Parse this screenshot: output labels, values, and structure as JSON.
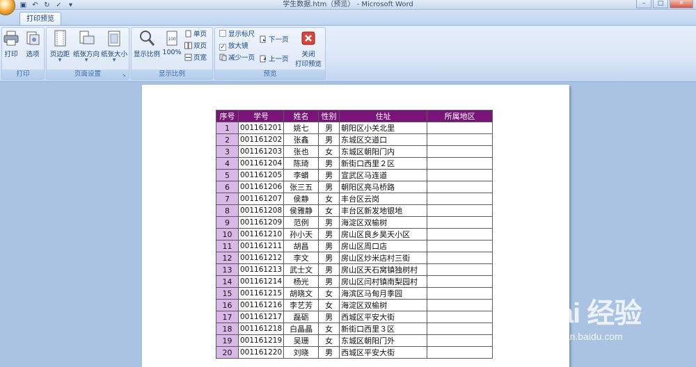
{
  "window": {
    "title": "学生数据.htm（预览） - Microsoft Word"
  },
  "tabs": [
    {
      "label": "打印预览"
    }
  ],
  "ribbon": {
    "print_group": {
      "label": "打印",
      "print": "打印",
      "options": "选项"
    },
    "page_setup_group": {
      "label": "页面设置",
      "margins": "页边距",
      "orientation": "纸张方向",
      "size": "纸张大小"
    },
    "zoom_group": {
      "label": "显示比例",
      "zoom": "显示比例",
      "hundred": "100%",
      "one_page": "单页",
      "two_pages": "双页",
      "page_width": "页宽"
    },
    "preview_group": {
      "label": "预览",
      "show_ruler": "显示标尺",
      "show_ruler_checked": false,
      "magnifier": "放大镜",
      "magnifier_checked": true,
      "shrink": "减少一页",
      "next_page": "下一页",
      "prev_page": "上一页",
      "close": "关闭",
      "close2": "打印预览"
    }
  },
  "table": {
    "headers": [
      "序号",
      "学号",
      "姓名",
      "性别",
      "住址",
      "所属地区"
    ],
    "rows": [
      [
        "1",
        "001161201",
        "姚七",
        "男",
        "朝阳区小关北里",
        ""
      ],
      [
        "2",
        "001161202",
        "张鑫",
        "男",
        "东城区交道口",
        ""
      ],
      [
        "3",
        "001161203",
        "张也",
        "女",
        "东城区朝阳门内",
        ""
      ],
      [
        "4",
        "001161204",
        "陈琦",
        "男",
        "新街口西里２区",
        ""
      ],
      [
        "5",
        "001161205",
        "李蟒",
        "男",
        "宣武区马连道",
        ""
      ],
      [
        "6",
        "001161206",
        "张三五",
        "男",
        "朝阳区亮马桥路",
        ""
      ],
      [
        "7",
        "001161207",
        "侯静",
        "女",
        "丰台区云岗",
        ""
      ],
      [
        "8",
        "001161208",
        "侯雅静",
        "女",
        "丰台区新发地银地",
        ""
      ],
      [
        "9",
        "001161209",
        "范例",
        "男",
        "海淀区双榆树",
        ""
      ],
      [
        "10",
        "001161210",
        "孙小天",
        "男",
        "房山区良乡昊天小区",
        ""
      ],
      [
        "11",
        "001161211",
        "胡昌",
        "男",
        "房山区周口店",
        ""
      ],
      [
        "12",
        "001161212",
        "李文",
        "男",
        "房山区炒米店村三街",
        ""
      ],
      [
        "13",
        "001161213",
        "武士文",
        "男",
        "房山区天石窝镇独树村",
        ""
      ],
      [
        "14",
        "001161214",
        "杨光",
        "男",
        "房山区闫村镇南梨园村",
        ""
      ],
      [
        "15",
        "001161215",
        "胡晓文",
        "女",
        "海滨区马甸月季园",
        ""
      ],
      [
        "16",
        "001161216",
        "李艺芳",
        "女",
        "海淀区双榆树",
        ""
      ],
      [
        "17",
        "001161217",
        "磊砺",
        "男",
        "西城区平安大街",
        ""
      ],
      [
        "18",
        "001161218",
        "白晶晶",
        "女",
        "新街口西里３区",
        ""
      ],
      [
        "19",
        "001161219",
        "吴珊",
        "女",
        "东城区朝阳门外",
        ""
      ],
      [
        "20",
        "001161220",
        "刘晓",
        "男",
        "西城区平安大街",
        ""
      ]
    ]
  },
  "watermark": {
    "logo": "Bai 经验",
    "url": "jingyan.baidu.com"
  },
  "colors": {
    "header_bg": "#7a147a",
    "index_bg": "#d9b8e8",
    "workspace_bg": "#abc3e2"
  }
}
